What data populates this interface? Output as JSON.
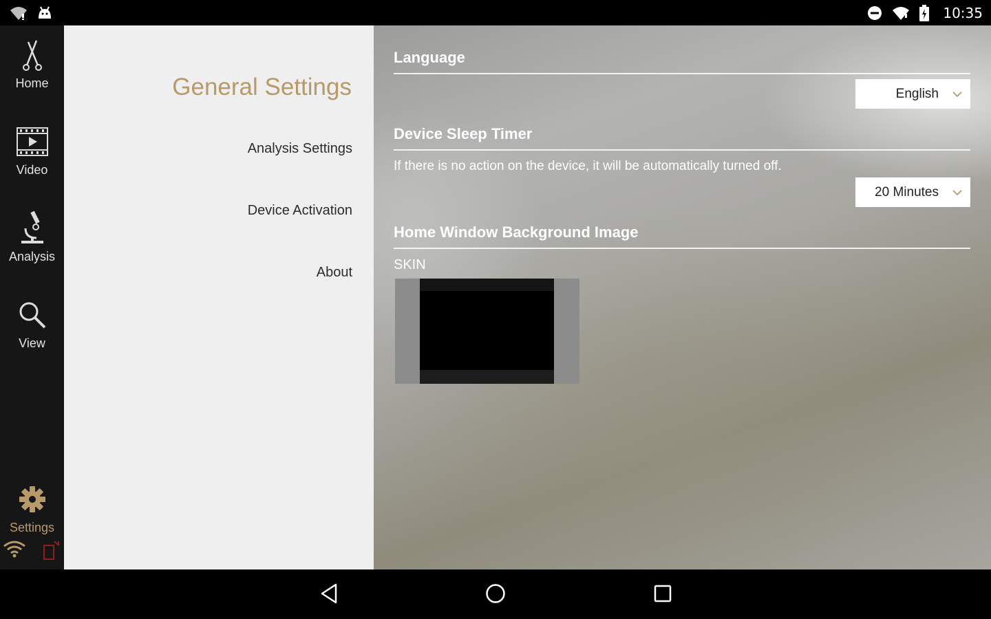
{
  "status_bar": {
    "time": "10:35",
    "icons": [
      "wifi-alert-icon",
      "android-icon",
      "do-not-disturb-icon",
      "wifi-icon",
      "battery-charging-icon"
    ]
  },
  "nav": {
    "items": [
      {
        "label": "Home",
        "icon": "home-scissors-icon"
      },
      {
        "label": "Video",
        "icon": "film-icon"
      },
      {
        "label": "Analysis",
        "icon": "microscope-icon"
      },
      {
        "label": "View",
        "icon": "search-icon"
      },
      {
        "label": "Settings",
        "icon": "gear-icon"
      }
    ],
    "active": "Settings",
    "bottom_icons": [
      "wifi-icon",
      "device-disconnected-icon"
    ]
  },
  "menu": {
    "title": "General Settings",
    "items": [
      "Analysis Settings",
      "Device Activation",
      "About"
    ]
  },
  "content": {
    "language": {
      "heading": "Language",
      "value": "English"
    },
    "sleep_timer": {
      "heading": "Device Sleep Timer",
      "description": "If there is no action on the device, it will be automatically turned off.",
      "value": "20 Minutes"
    },
    "background": {
      "heading": "Home Window Background Image",
      "skin_label": "SKIN"
    }
  },
  "colors": {
    "accent": "#b79a6a",
    "rail": "#161616",
    "menu_bg": "#efefef"
  },
  "system_nav": [
    "back-icon",
    "home-circle-icon",
    "recents-icon"
  ]
}
